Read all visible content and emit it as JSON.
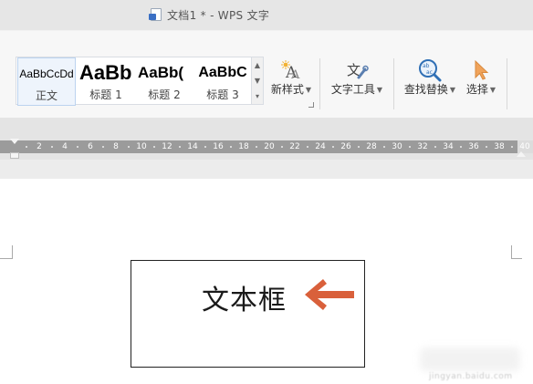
{
  "window": {
    "title": "文档1 * - WPS 文字",
    "doc_icon": "wps-writer-doc-icon"
  },
  "ribbon": {
    "styles": [
      {
        "preview": "AaBbCcDd",
        "name": "正文",
        "selected": true
      },
      {
        "preview": "AaBb",
        "name": "标题 1"
      },
      {
        "preview": "AaBb(",
        "name": "标题 2"
      },
      {
        "preview": "AaBbC",
        "name": "标题 3"
      }
    ],
    "new_style": {
      "label": "新样式",
      "icon": "new-style-icon"
    },
    "text_tools": {
      "label": "文字工具",
      "icon": "text-tools-icon"
    },
    "find_replace": {
      "label": "查找替换",
      "icon": "find-replace-icon"
    },
    "select": {
      "label": "选择",
      "icon": "select-cursor-icon"
    }
  },
  "ruler": {
    "ticks": [
      "2",
      "4",
      "6",
      "8",
      "10",
      "12",
      "14",
      "16",
      "18",
      "20",
      "22",
      "24",
      "26",
      "28",
      "30",
      "32",
      "34",
      "36",
      "38",
      "40"
    ]
  },
  "document": {
    "textbox_text": "文本框",
    "annotation_arrow_color": "#d9603b"
  },
  "watermark": {
    "text": "jingyan.baidu.com"
  },
  "colors": {
    "titlebar_bg": "#e6e6e6",
    "ribbon_bg": "#f7f7f7",
    "ruler_bg": "#9b9b9b",
    "select_cursor": "#f0a35a",
    "find_icon": "#2f6fb5"
  }
}
